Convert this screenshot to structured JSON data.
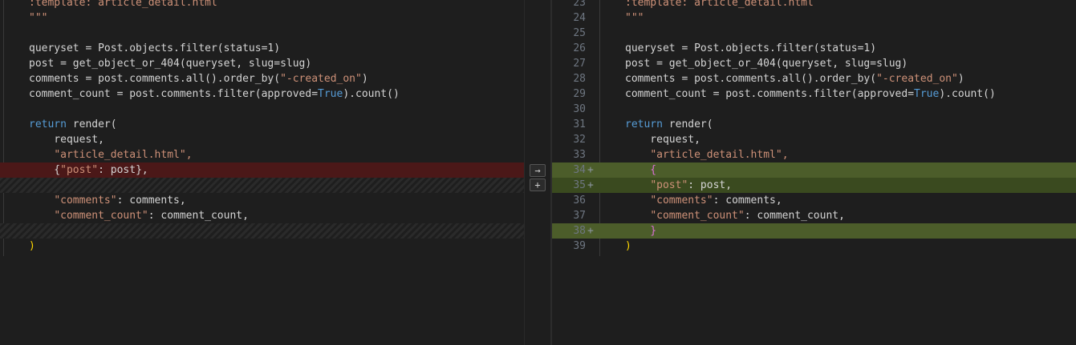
{
  "left": {
    "lines": [
      ":template: article_detail.html",
      "\"\"\"",
      "",
      "queryset = Post.objects.filter(status=1)",
      "post = get_object_or_404(queryset, slug=slug)",
      "comments = post.comments.all().order_by(\"-created_on\")",
      "comment_count = post.comments.filter(approved=True).count()",
      "",
      "return render(",
      "    request,",
      "    \"article_detail.html\",",
      "    {\"post\": post},",
      "",
      "    \"comments\": comments,",
      "    \"comment_count\": comment_count,",
      "",
      ")"
    ]
  },
  "right": {
    "line_numbers": [
      "23",
      "24",
      "25",
      "26",
      "27",
      "28",
      "29",
      "30",
      "31",
      "32",
      "33",
      "34",
      "35",
      "36",
      "37",
      "38",
      "39"
    ],
    "markers": [
      "",
      "",
      "",
      "",
      "",
      "",
      "",
      "",
      "",
      "",
      "",
      "+",
      "+",
      "",
      "",
      "+",
      ""
    ],
    "lines": [
      ":template: article_detail.html",
      "\"\"\"",
      "",
      "queryset = Post.objects.filter(status=1)",
      "post = get_object_or_404(queryset, slug=slug)",
      "comments = post.comments.all().order_by(\"-created_on\")",
      "comment_count = post.comments.filter(approved=True).count()",
      "",
      "return render(",
      "    request,",
      "    \"article_detail.html\",",
      "    {",
      "    \"post\": post,",
      "    \"comments\": comments,",
      "    \"comment_count\": comment_count,",
      "    }",
      ")"
    ]
  },
  "gutter": {
    "apply_icon": "→",
    "add_icon": "+"
  },
  "colors": {
    "removed_bg": "#4b1818",
    "added_bg": "#3a4a1f",
    "keyword": "#569cd6",
    "string": "#ce9178"
  }
}
